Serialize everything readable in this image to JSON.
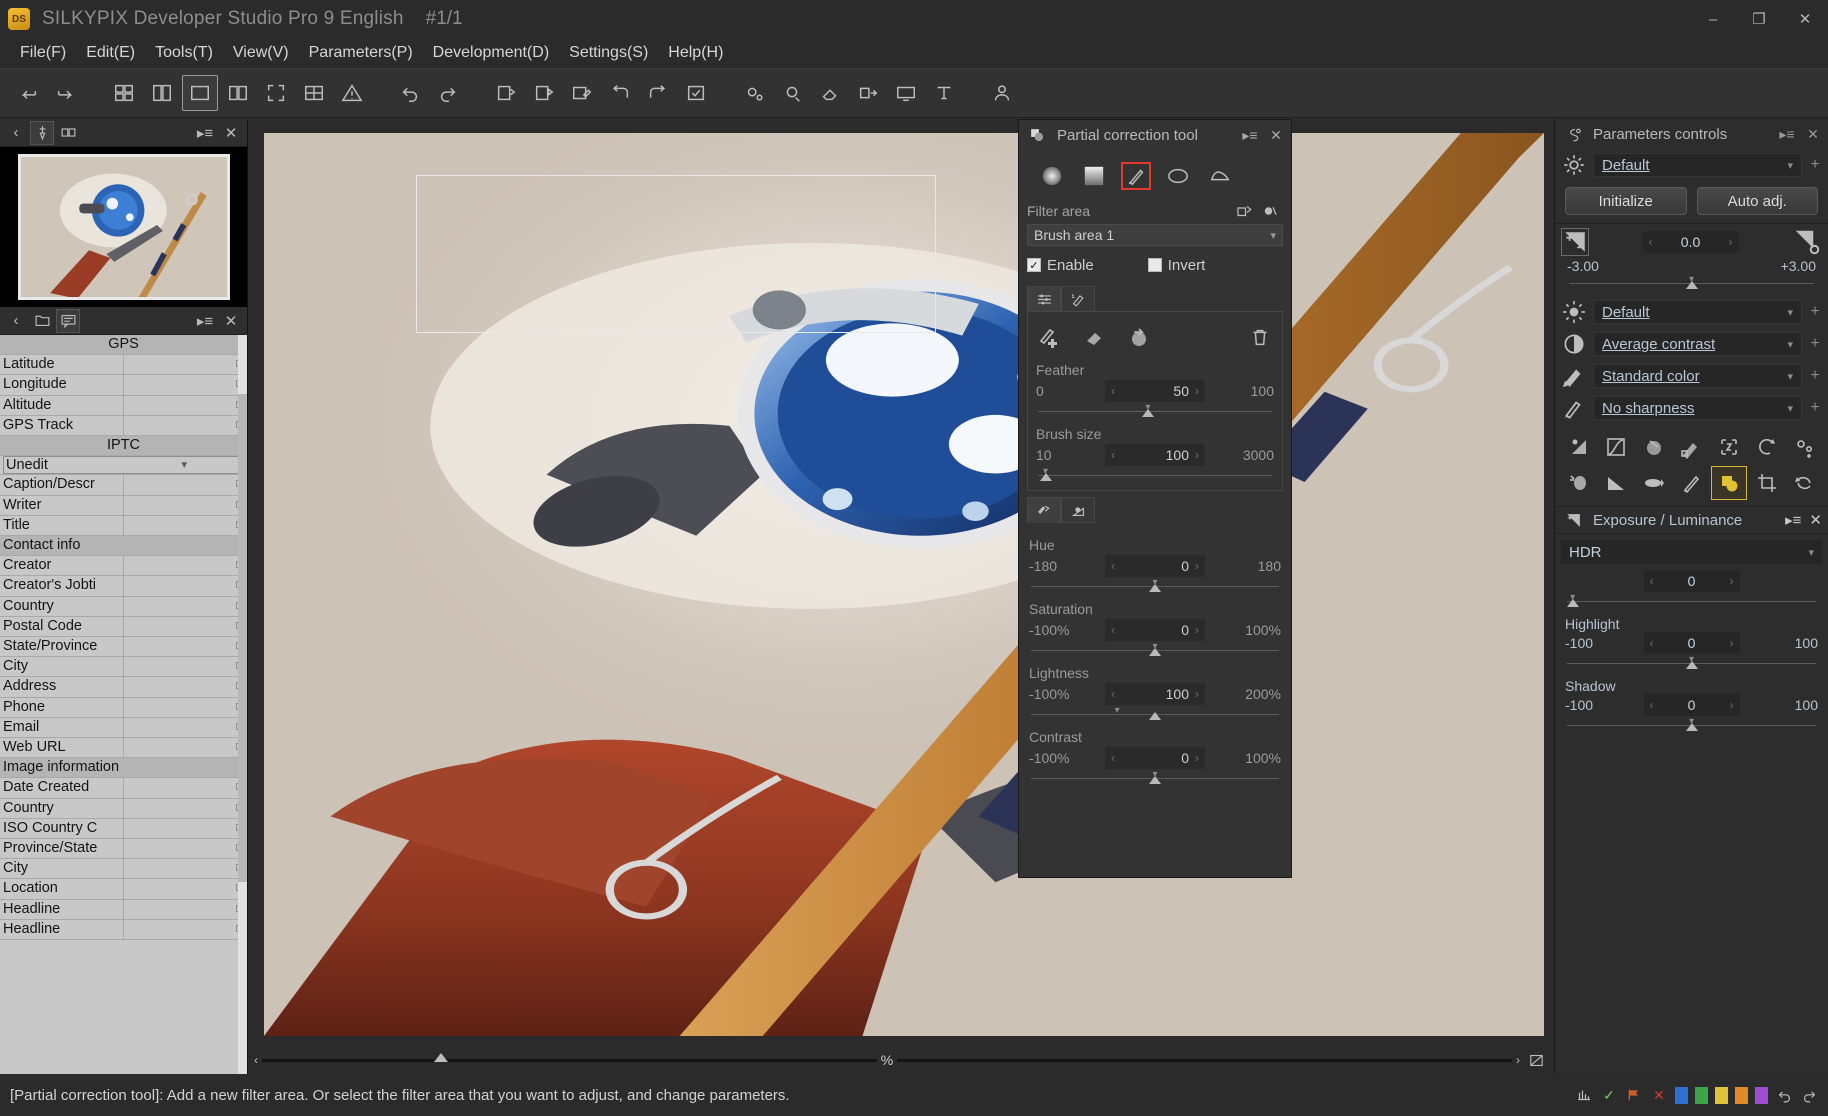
{
  "window": {
    "logo_text": "DS",
    "title": "SILKYPIX Developer Studio Pro 9 English",
    "counter": "#1/1",
    "minimize": "–",
    "maximize": "❐",
    "close": "✕"
  },
  "menubar": [
    {
      "label": "File(F)",
      "name": "menu-file"
    },
    {
      "label": "Edit(E)",
      "name": "menu-edit"
    },
    {
      "label": "Tools(T)",
      "name": "menu-tools"
    },
    {
      "label": "View(V)",
      "name": "menu-view"
    },
    {
      "label": "Parameters(P)",
      "name": "menu-parameters"
    },
    {
      "label": "Development(D)",
      "name": "menu-development"
    },
    {
      "label": "Settings(S)",
      "name": "menu-settings"
    },
    {
      "label": "Help(H)",
      "name": "menu-help"
    }
  ],
  "toolbar": {
    "items": [
      {
        "name": "back-arrow-icon"
      },
      {
        "name": "forward-arrow-icon"
      },
      {
        "name": "thumbnail-grid-icon"
      },
      {
        "name": "split-view-icon"
      },
      {
        "name": "single-view-icon"
      },
      {
        "name": "two-pane-view-icon"
      },
      {
        "name": "fullscreen-icon"
      },
      {
        "name": "multi-view-icon"
      },
      {
        "name": "warning-icon"
      },
      {
        "name": "undo-icon"
      },
      {
        "name": "redo-icon"
      },
      {
        "name": "copy-params-icon"
      },
      {
        "name": "paste-params-icon"
      },
      {
        "name": "edit-params-icon"
      },
      {
        "name": "rotate-left-icon"
      },
      {
        "name": "rotate-right-icon"
      },
      {
        "name": "checkmark-box-icon"
      },
      {
        "name": "batch-gear-icon"
      },
      {
        "name": "develop-check-icon"
      },
      {
        "name": "eraser-icon"
      },
      {
        "name": "export-icon"
      },
      {
        "name": "display-icon"
      },
      {
        "name": "print-icon"
      },
      {
        "name": "user-icon"
      }
    ]
  },
  "left_panel": {
    "tabs_top": [
      {
        "name": "collapse-left-icon",
        "glyph": "‹"
      },
      {
        "name": "pin-icon"
      },
      {
        "name": "compare-icon"
      },
      {
        "name": "panel-menu-icon",
        "glyph": "▸≡"
      },
      {
        "name": "panel-close-icon",
        "glyph": "✕"
      }
    ],
    "tabs_bottom": [
      {
        "name": "collapse-left-icon",
        "glyph": "‹"
      },
      {
        "name": "folder-tab-icon"
      },
      {
        "name": "metadata-tab-icon"
      },
      {
        "name": "panel-menu-icon",
        "glyph": "▸≡"
      },
      {
        "name": "panel-close-icon",
        "glyph": "✕"
      }
    ],
    "metadata": {
      "iptc_selector_value": "Unedit",
      "rows": [
        {
          "type": "section",
          "label": "GPS"
        },
        {
          "type": "field",
          "label": "Latitude",
          "value": ""
        },
        {
          "type": "field",
          "label": "Longitude",
          "value": ""
        },
        {
          "type": "field",
          "label": "Altitude",
          "value": ""
        },
        {
          "type": "field",
          "label": "GPS Track",
          "value": ""
        },
        {
          "type": "section",
          "label": "IPTC"
        },
        {
          "type": "dropdown",
          "label": "Unedit"
        },
        {
          "type": "field",
          "label": "Caption/Descr",
          "value": ""
        },
        {
          "type": "field",
          "label": "Writer",
          "value": ""
        },
        {
          "type": "field",
          "label": "Title",
          "value": ""
        },
        {
          "type": "group",
          "label": "Contact info"
        },
        {
          "type": "field",
          "label": "Creator",
          "value": ""
        },
        {
          "type": "field",
          "label": "Creator's Jobti",
          "value": ""
        },
        {
          "type": "field",
          "label": "Country",
          "value": ""
        },
        {
          "type": "field",
          "label": "Postal Code",
          "value": ""
        },
        {
          "type": "field",
          "label": "State/Province",
          "value": ""
        },
        {
          "type": "field",
          "label": "City",
          "value": ""
        },
        {
          "type": "field",
          "label": "Address",
          "value": ""
        },
        {
          "type": "field",
          "label": "Phone",
          "value": ""
        },
        {
          "type": "field",
          "label": "Email",
          "value": ""
        },
        {
          "type": "field",
          "label": "Web URL",
          "value": ""
        },
        {
          "type": "group",
          "label": "Image information"
        },
        {
          "type": "field",
          "label": "Date Created",
          "value": ""
        },
        {
          "type": "field",
          "label": "Country",
          "value": ""
        },
        {
          "type": "field",
          "label": "ISO Country C",
          "value": ""
        },
        {
          "type": "field",
          "label": "Province/State",
          "value": ""
        },
        {
          "type": "field",
          "label": "City",
          "value": ""
        },
        {
          "type": "field",
          "label": "Location",
          "value": ""
        },
        {
          "type": "field",
          "label": "Headline",
          "value": ""
        },
        {
          "type": "field",
          "label": "Headline",
          "value": ""
        }
      ]
    }
  },
  "viewer": {
    "zoom_percent_label": "%",
    "zoom_left_caret": "‹",
    "zoom_right_caret": "›"
  },
  "partial_correction": {
    "title": "Partial correction tool",
    "menu_glyph": "▸≡",
    "close_glyph": "✕",
    "shapes": [
      {
        "name": "shape-circular-gradation-icon",
        "selected": false
      },
      {
        "name": "shape-linear-gradation-icon",
        "selected": false
      },
      {
        "name": "shape-brush-icon",
        "selected": true
      },
      {
        "name": "shape-ellipse-icon",
        "selected": false
      },
      {
        "name": "shape-free-form-icon",
        "selected": false
      }
    ],
    "filter_area_label": "Filter area",
    "filter_area_value": "Brush area 1",
    "enable_label": "Enable",
    "enable_checked": true,
    "invert_label": "Invert",
    "invert_checked": false,
    "tabs": [
      {
        "name": "tab-area-settings-icon",
        "active": true
      },
      {
        "name": "tab-brush-settings-icon",
        "active": false
      }
    ],
    "brush_tools": [
      {
        "name": "brush-add-icon"
      },
      {
        "name": "brush-eraser-icon"
      },
      {
        "name": "brush-invert-icon"
      },
      {
        "name": "brush-delete-icon"
      }
    ],
    "sliders": [
      {
        "label": "Feather",
        "min": "0",
        "value": "50",
        "max": "100",
        "thumb_pct": 50,
        "name": "feather-slider"
      },
      {
        "label": "Brush size",
        "min": "10",
        "value": "100",
        "max": "3000",
        "thumb_pct": 3,
        "name": "brush-size-slider"
      }
    ],
    "color_tabs": [
      {
        "name": "tab-color-icon",
        "active": true
      },
      {
        "name": "tab-exposure-icon",
        "active": false
      }
    ],
    "color_sliders": [
      {
        "label": "Hue",
        "min": "-180",
        "value": "0",
        "max": "180",
        "thumb_pct": 50,
        "name": "hue-slider"
      },
      {
        "label": "Saturation",
        "min": "-100%",
        "value": "0",
        "max": "100%",
        "thumb_pct": 50,
        "name": "saturation-slider"
      },
      {
        "label": "Lightness",
        "min": "-100%",
        "value": "100",
        "max": "200%",
        "thumb_pct": 33,
        "name": "lightness-slider"
      },
      {
        "label": "Contrast",
        "min": "-100%",
        "value": "0",
        "max": "100%",
        "thumb_pct": 50,
        "name": "contrast-slider"
      }
    ]
  },
  "parameters_controls": {
    "title": "Parameters controls",
    "menu_glyph": "▸≡",
    "close_glyph": "✕",
    "taste_preset": "Default",
    "buttons": {
      "initialize": "Initialize",
      "auto_adj": "Auto adj."
    },
    "exposure": {
      "value": "0.0",
      "min": "-3.00",
      "max": "+3.00",
      "thumb_pct": 50
    },
    "presets": [
      {
        "icon": "brightness-icon",
        "value": "Default",
        "name": "tone-preset"
      },
      {
        "icon": "contrast-icon",
        "value": "Average contrast",
        "name": "contrast-preset"
      },
      {
        "icon": "color-icon",
        "value": "Standard color",
        "name": "color-preset"
      },
      {
        "icon": "sharpness-icon",
        "value": "No sharpness",
        "name": "sharpness-preset"
      }
    ],
    "tool_grid": [
      {
        "name": "exposure-tool-icon",
        "selected": false
      },
      {
        "name": "tone-curve-tool-icon",
        "selected": false
      },
      {
        "name": "white-balance-tool-icon",
        "selected": false
      },
      {
        "name": "color-tool-icon",
        "selected": false
      },
      {
        "name": "noise-reduction-tool-icon",
        "selected": false
      },
      {
        "name": "lens-aberration-tool-icon",
        "selected": false
      },
      {
        "name": "settings-tool-icon",
        "selected": false
      },
      {
        "name": "dodge-burn-tool-icon",
        "selected": false
      },
      {
        "name": "gradation-tool-icon",
        "selected": false
      },
      {
        "name": "fisheye-tool-icon",
        "selected": false
      },
      {
        "name": "sharpness-tool-icon",
        "selected": false
      },
      {
        "name": "partial-correction-tool-icon",
        "selected": true
      },
      {
        "name": "crop-tool-icon",
        "selected": false
      },
      {
        "name": "rotation-tool-icon",
        "selected": false
      }
    ]
  },
  "exposure_luminance": {
    "title": "Exposure / Luminance",
    "menu_glyph": "▸≡",
    "close_glyph": "✕",
    "hdr_label": "HDR",
    "hdr_value": "0",
    "sliders": [
      {
        "label": "Highlight",
        "min": "-100",
        "value": "0",
        "max": "100",
        "thumb_pct": 50,
        "name": "highlight-slider"
      },
      {
        "label": "Shadow",
        "min": "-100",
        "value": "0",
        "max": "100",
        "thumb_pct": 50,
        "name": "shadow-slider"
      }
    ]
  },
  "statusbar": {
    "message": "[Partial correction tool]: Add a new filter area. Or select the filter area that you want to adjust, and change parameters.",
    "rating_check": "✓",
    "swatches": [
      "#cf5d2a",
      "#d23b30",
      "#2f6fd0",
      "#3aa54b",
      "#e0c33a",
      "#e08a2a",
      "#9b4fd0"
    ],
    "icons": [
      {
        "name": "histogram-icon"
      },
      {
        "name": "check-mark-icon"
      },
      {
        "name": "flag-icon"
      },
      {
        "name": "reject-icon"
      },
      {
        "name": "undo-status-icon"
      },
      {
        "name": "redo-status-icon"
      }
    ]
  }
}
